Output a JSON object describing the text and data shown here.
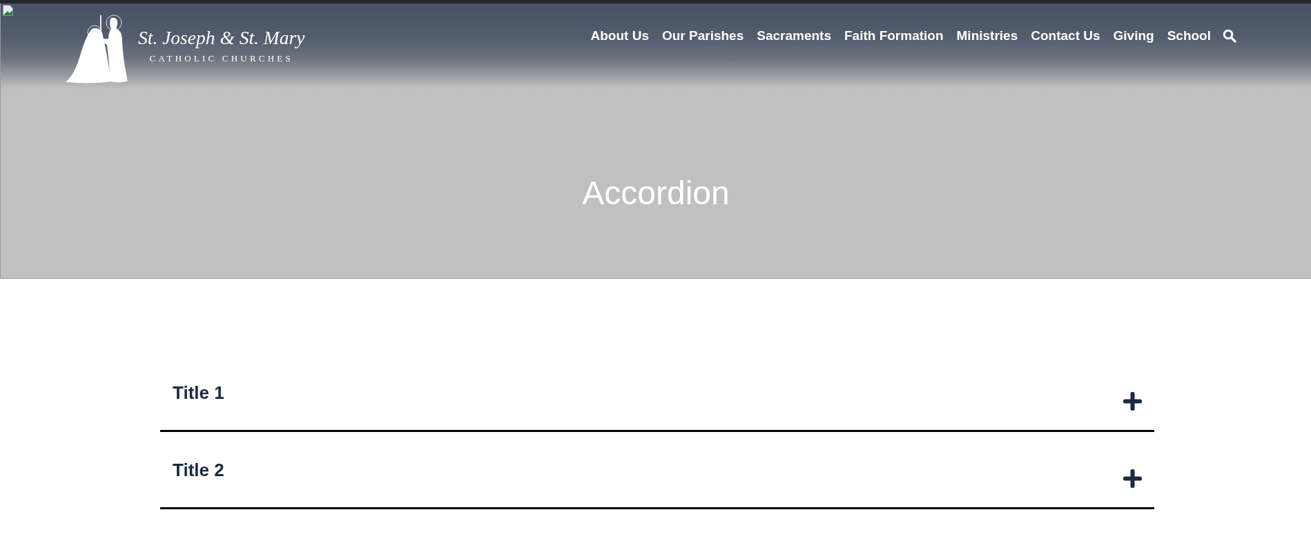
{
  "header": {
    "logo": {
      "title": "St. Joseph & St. Mary",
      "subtitle": "CATHOLIC CHURCHES"
    },
    "nav": [
      "About Us",
      "Our Parishes",
      "Sacraments",
      "Faith Formation",
      "Ministries",
      "Contact Us",
      "Giving",
      "School"
    ]
  },
  "hero": {
    "title": "Accordion"
  },
  "accordion": [
    {
      "title": "Title 1",
      "expanded": false
    },
    {
      "title": "Title 2",
      "expanded": false
    }
  ]
}
